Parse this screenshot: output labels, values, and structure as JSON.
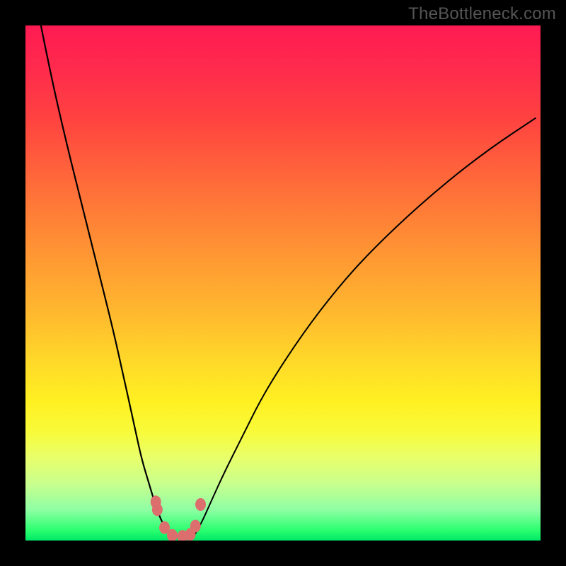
{
  "watermark": "TheBottleneck.com",
  "chart_data": {
    "type": "line",
    "title": "",
    "xlabel": "",
    "ylabel": "",
    "xlim": [
      0,
      100
    ],
    "ylim": [
      0,
      100
    ],
    "series": [
      {
        "name": "left-branch",
        "x": [
          3,
          5,
          8,
          11,
          14,
          17,
          19,
          21,
          22.5,
          24,
          25.5,
          27,
          28.5
        ],
        "y": [
          100,
          90,
          77,
          65,
          53,
          41,
          32,
          23,
          16,
          11,
          6,
          2.5,
          0.5
        ]
      },
      {
        "name": "right-branch",
        "x": [
          32.5,
          34,
          36,
          38.5,
          42,
          46,
          51,
          57,
          64,
          72,
          81,
          90,
          99
        ],
        "y": [
          0.5,
          3,
          7.5,
          13,
          20,
          28,
          36,
          44.5,
          53,
          61,
          69,
          76,
          82
        ]
      }
    ],
    "markers": {
      "name": "bottom-cluster",
      "color": "#dd6e6e",
      "points": [
        {
          "x": 25.3,
          "y": 7.5
        },
        {
          "x": 25.6,
          "y": 6.0
        },
        {
          "x": 27.0,
          "y": 2.5
        },
        {
          "x": 28.5,
          "y": 1.0
        },
        {
          "x": 30.5,
          "y": 0.8
        },
        {
          "x": 32.0,
          "y": 1.2
        },
        {
          "x": 33.0,
          "y": 2.8
        },
        {
          "x": 34.0,
          "y": 7.0
        }
      ]
    }
  }
}
